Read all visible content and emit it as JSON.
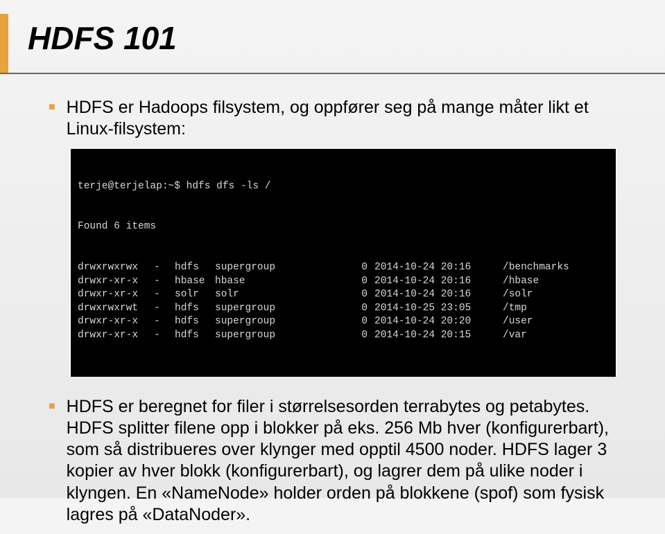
{
  "title": "HDFS 101",
  "bullet1": "HDFS er Hadoops filsystem, og oppfører seg på mange måter likt et Linux-filsystem:",
  "bullet2": "HDFS er beregnet for filer i størrelsesorden terrabytes og petabytes. HDFS splitter filene opp i blokker på eks. 256 Mb hver (konfigurerbart), som så distribueres over klynger med opptil 4500 noder. HDFS lager 3 kopier av hver blokk (konfigurerbart), og lagrer dem på ulike noder i klyngen. En «NameNode» holder orden på blokkene (spof) som fysisk lagres på «DataNoder».",
  "terminal": {
    "prompt": "terje@terjelap:~$ hdfs dfs -ls /",
    "found": "Found 6 items",
    "rows": [
      {
        "perm": "drwxrwxrwx",
        "dash": "-",
        "user": "hdfs",
        "group": "supergroup",
        "size": "0",
        "date": "2014-10-24 20:16",
        "path": "/benchmarks"
      },
      {
        "perm": "drwxr-xr-x",
        "dash": "-",
        "user": "hbase",
        "group": "hbase",
        "size": "0",
        "date": "2014-10-24 20:16",
        "path": "/hbase"
      },
      {
        "perm": "drwxr-xr-x",
        "dash": "-",
        "user": "solr",
        "group": "solr",
        "size": "0",
        "date": "2014-10-24 20:16",
        "path": "/solr"
      },
      {
        "perm": "drwxrwxrwt",
        "dash": "-",
        "user": "hdfs",
        "group": "supergroup",
        "size": "0",
        "date": "2014-10-25 23:05",
        "path": "/tmp"
      },
      {
        "perm": "drwxr-xr-x",
        "dash": "-",
        "user": "hdfs",
        "group": "supergroup",
        "size": "0",
        "date": "2014-10-24 20:20",
        "path": "/user"
      },
      {
        "perm": "drwxr-xr-x",
        "dash": "-",
        "user": "hdfs",
        "group": "supergroup",
        "size": "0",
        "date": "2014-10-24 20:15",
        "path": "/var"
      }
    ]
  }
}
